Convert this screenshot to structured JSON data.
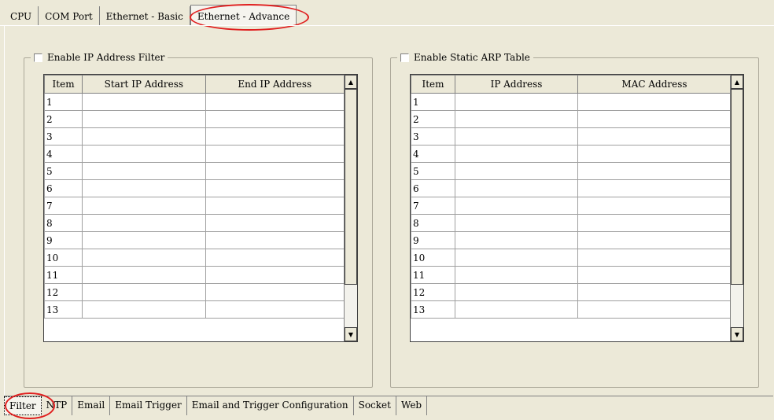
{
  "top_tabs": [
    "CPU",
    "COM Port",
    "Ethernet - Basic",
    "Ethernet - Advance"
  ],
  "active_top_tab": "Ethernet - Advance",
  "ip_filter": {
    "checkbox_label": "Enable IP Address Filter",
    "checked": false,
    "columns": [
      "Item",
      "Start IP Address",
      "End IP Address"
    ],
    "rows": [
      "1",
      "2",
      "3",
      "4",
      "5",
      "6",
      "7",
      "8",
      "9",
      "10",
      "11",
      "12",
      "13"
    ]
  },
  "arp_table": {
    "checkbox_label": "Enable Static ARP Table",
    "checked": false,
    "columns": [
      "Item",
      "IP Address",
      "MAC Address"
    ],
    "rows": [
      "1",
      "2",
      "3",
      "4",
      "5",
      "6",
      "7",
      "8",
      "9",
      "10",
      "11",
      "12",
      "13"
    ]
  },
  "bottom_tabs": [
    "Filter",
    "NTP",
    "Email",
    "Email Trigger",
    "Email and Trigger Configuration",
    "Socket",
    "Web"
  ],
  "active_bottom_tab": "Filter",
  "highlight_color": "#e02020"
}
